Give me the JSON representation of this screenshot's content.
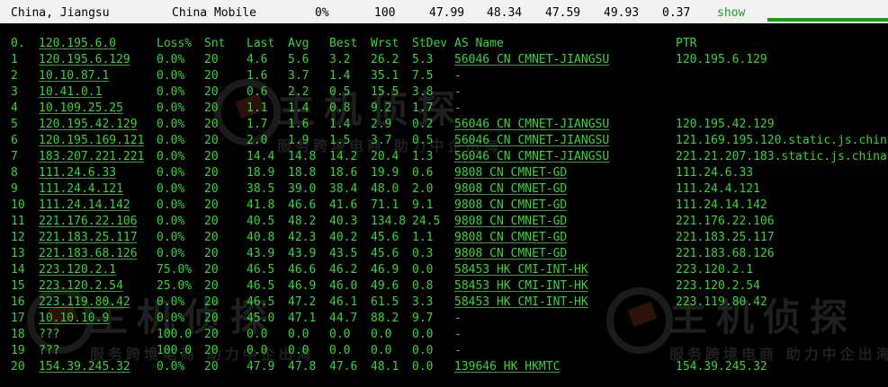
{
  "header": {
    "location": "China, Jiangsu",
    "isp": "China Mobile",
    "loss": "0%",
    "sent": "100",
    "last": "47.99",
    "avg": "48.34",
    "best": "47.59",
    "worst": "49.93",
    "stdev": "0.37",
    "toggle_label": "show"
  },
  "watermarks": [
    {
      "big": "主机侦探",
      "small": "服务跨境电商 助力中企出海"
    },
    {
      "big": "主机侦探",
      "small": "服务跨境电商 助力中企出海"
    },
    {
      "big": "主机侦探",
      "small": "服务跨境电商 助力中企出海"
    }
  ],
  "table": {
    "columns": [
      "",
      "Loss%",
      "Snt",
      "Last",
      "Avg",
      "Best",
      "Wrst",
      "StDev",
      "AS Name",
      "PTR"
    ],
    "rows": [
      [
        "0.",
        "120.195.6.0",
        "",
        "",
        "",
        "",
        "",
        "",
        "",
        "",
        ""
      ],
      [
        "1",
        "120.195.6.129",
        "0.0%",
        "20",
        "4.6",
        "5.6",
        "3.2",
        "26.2",
        "5.3",
        "56046 CN CMNET-JIANGSU",
        "120.195.6.129"
      ],
      [
        "2",
        "10.10.87.1",
        "0.0%",
        "20",
        "1.6",
        "3.7",
        "1.4",
        "35.1",
        "7.5",
        "-",
        ""
      ],
      [
        "3",
        "10.41.0.1",
        "0.0%",
        "20",
        "0.6",
        "2.2",
        "0.5",
        "15.5",
        "3.8",
        "-",
        ""
      ],
      [
        "4",
        "10.109.25.25",
        "0.0%",
        "20",
        "1.1",
        "1.4",
        "0.8",
        "9.2",
        "1.7",
        "-",
        ""
      ],
      [
        "5",
        "120.195.42.129",
        "0.0%",
        "20",
        "1.7",
        "1.6",
        "1.4",
        "2.9",
        "0.2",
        "56046 CN CMNET-JIANGSU",
        "120.195.42.129"
      ],
      [
        "6",
        "120.195.169.121",
        "0.0%",
        "20",
        "2.0",
        "1.9",
        "1.5",
        "3.7",
        "0.5",
        "56046 CN CMNET-JIANGSU",
        "121.169.195.120.static.js.chin"
      ],
      [
        "7",
        "183.207.221.221",
        "0.0%",
        "20",
        "14.4",
        "14.8",
        "14.2",
        "20.4",
        "1.3",
        "56046 CN CMNET-JIANGSU",
        "221.21.207.183.static.js.china"
      ],
      [
        "8",
        "111.24.6.33",
        "0.0%",
        "20",
        "18.9",
        "18.8",
        "18.6",
        "19.9",
        "0.6",
        "9808 CN CMNET-GD",
        "111.24.6.33"
      ],
      [
        "9",
        "111.24.4.121",
        "0.0%",
        "20",
        "38.5",
        "39.0",
        "38.4",
        "48.0",
        "2.0",
        "9808 CN CMNET-GD",
        "111.24.4.121"
      ],
      [
        "10",
        "111.24.14.142",
        "0.0%",
        "20",
        "41.8",
        "46.6",
        "41.6",
        "71.1",
        "9.1",
        "9808 CN CMNET-GD",
        "111.24.14.142"
      ],
      [
        "11",
        "221.176.22.106",
        "0.0%",
        "20",
        "40.5",
        "48.2",
        "40.3",
        "134.8",
        "24.5",
        "9808 CN CMNET-GD",
        "221.176.22.106"
      ],
      [
        "12",
        "221.183.25.117",
        "0.0%",
        "20",
        "40.8",
        "42.3",
        "40.2",
        "45.6",
        "1.1",
        "9808 CN CMNET-GD",
        "221.183.25.117"
      ],
      [
        "13",
        "221.183.68.126",
        "0.0%",
        "20",
        "43.9",
        "43.9",
        "43.5",
        "45.6",
        "0.3",
        "9808 CN CMNET-GD",
        "221.183.68.126"
      ],
      [
        "14",
        "223.120.2.1",
        "75.0%",
        "20",
        "46.5",
        "46.6",
        "46.2",
        "46.9",
        "0.0",
        "58453 HK CMI-INT-HK",
        "223.120.2.1"
      ],
      [
        "15",
        "223.120.2.54",
        "25.0%",
        "20",
        "46.5",
        "46.9",
        "46.0",
        "49.6",
        "0.8",
        "58453 HK CMI-INT-HK",
        "223.120.2.54"
      ],
      [
        "16",
        "223.119.80.42",
        "0.0%",
        "20",
        "46.5",
        "47.2",
        "46.1",
        "61.5",
        "3.3",
        "58453 HK CMI-INT-HK",
        "223.119.80.42"
      ],
      [
        "17",
        "10.10.10.9",
        "0.0%",
        "20",
        "45.0",
        "47.1",
        "44.7",
        "88.2",
        "9.7",
        "-",
        ""
      ],
      [
        "18",
        "???",
        "100.0",
        "20",
        "0.0",
        "0.0",
        "0.0",
        "0.0",
        "0.0",
        "-",
        ""
      ],
      [
        "19",
        "???",
        "100.0",
        "20",
        "0.0",
        "0.0",
        "0.0",
        "0.0",
        "0.0",
        "-",
        ""
      ],
      [
        "20",
        "154.39.245.32",
        "0.0%",
        "20",
        "47.9",
        "47.8",
        "47.6",
        "48.1",
        "0.0",
        "139646 HK HKMTC",
        "154.39.245.32"
      ]
    ]
  }
}
